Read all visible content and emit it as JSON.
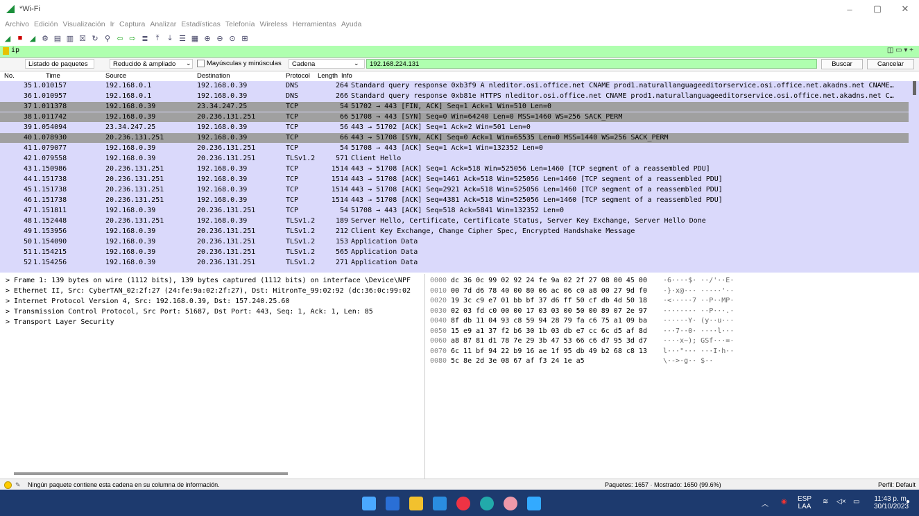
{
  "window": {
    "title": "*Wi-Fi",
    "minimize": "–",
    "maximize": "▢",
    "close": "✕"
  },
  "menu": [
    "Archivo",
    "Edición",
    "Visualización",
    "Ir",
    "Captura",
    "Analizar",
    "Estadísticas",
    "Telefonía",
    "Wireless",
    "Herramientas",
    "Ayuda"
  ],
  "filter": {
    "value": "ip",
    "right_controls": "◫ ▭ ▾ +"
  },
  "search": {
    "scope": "Listado de paquetes",
    "mode": "Reducido & ampliado",
    "case_label": "Mayúsculas y minúsculas",
    "type": "Cadena",
    "query": "192.168.224.131",
    "find": "Buscar",
    "cancel": "Cancelar"
  },
  "columns": {
    "no": "No.",
    "time": "Time",
    "source": "Source",
    "destination": "Destination",
    "protocol": "Protocol",
    "length": "Length",
    "info": "Info"
  },
  "packets": [
    {
      "no": "35",
      "time": "1.010157",
      "src": "192.168.0.1",
      "dst": "192.168.0.39",
      "proto": "DNS",
      "len": "264",
      "info": "Standard query response 0xb3f9 A nleditor.osi.office.net CNAME prod1.naturallanguageeditorservice.osi.office.net.akadns.net CNAME…",
      "style": "dns"
    },
    {
      "no": "36",
      "time": "1.010957",
      "src": "192.168.0.1",
      "dst": "192.168.0.39",
      "proto": "DNS",
      "len": "266",
      "info": "Standard query response 0xb81e HTTPS nleditor.osi.office.net CNAME prod1.naturallanguageeditorservice.osi.office.net.akadns.net C…",
      "style": "dns"
    },
    {
      "no": "37",
      "time": "1.011378",
      "src": "192.168.0.39",
      "dst": "23.34.247.25",
      "proto": "TCP",
      "len": "54",
      "info": "51702 → 443 [FIN, ACK] Seq=1 Ack=1 Win=510 Len=0",
      "style": "dark"
    },
    {
      "no": "38",
      "time": "1.011742",
      "src": "192.168.0.39",
      "dst": "20.236.131.251",
      "proto": "TCP",
      "len": "66",
      "info": "51708 → 443 [SYN] Seq=0 Win=64240 Len=0 MSS=1460 WS=256 SACK_PERM",
      "style": "dark"
    },
    {
      "no": "39",
      "time": "1.054094",
      "src": "23.34.247.25",
      "dst": "192.168.0.39",
      "proto": "TCP",
      "len": "56",
      "info": "443 → 51702 [ACK] Seq=1 Ack=2 Win=501 Len=0",
      "style": "tcp"
    },
    {
      "no": "40",
      "time": "1.078930",
      "src": "20.236.131.251",
      "dst": "192.168.0.39",
      "proto": "TCP",
      "len": "66",
      "info": "443 → 51708 [SYN, ACK] Seq=0 Ack=1 Win=65535 Len=0 MSS=1440 WS=256 SACK_PERM",
      "style": "dark"
    },
    {
      "no": "41",
      "time": "1.079077",
      "src": "192.168.0.39",
      "dst": "20.236.131.251",
      "proto": "TCP",
      "len": "54",
      "info": "51708 → 443 [ACK] Seq=1 Ack=1 Win=132352 Len=0",
      "style": "tcp"
    },
    {
      "no": "42",
      "time": "1.079558",
      "src": "192.168.0.39",
      "dst": "20.236.131.251",
      "proto": "TLSv1.2",
      "len": "571",
      "info": "Client Hello",
      "style": "tcp"
    },
    {
      "no": "43",
      "time": "1.150986",
      "src": "20.236.131.251",
      "dst": "192.168.0.39",
      "proto": "TCP",
      "len": "1514",
      "info": "443 → 51708 [ACK] Seq=1 Ack=518 Win=525056 Len=1460 [TCP segment of a reassembled PDU]",
      "style": "tcp"
    },
    {
      "no": "44",
      "time": "1.151738",
      "src": "20.236.131.251",
      "dst": "192.168.0.39",
      "proto": "TCP",
      "len": "1514",
      "info": "443 → 51708 [ACK] Seq=1461 Ack=518 Win=525056 Len=1460 [TCP segment of a reassembled PDU]",
      "style": "tcp"
    },
    {
      "no": "45",
      "time": "1.151738",
      "src": "20.236.131.251",
      "dst": "192.168.0.39",
      "proto": "TCP",
      "len": "1514",
      "info": "443 → 51708 [ACK] Seq=2921 Ack=518 Win=525056 Len=1460 [TCP segment of a reassembled PDU]",
      "style": "tcp"
    },
    {
      "no": "46",
      "time": "1.151738",
      "src": "20.236.131.251",
      "dst": "192.168.0.39",
      "proto": "TCP",
      "len": "1514",
      "info": "443 → 51708 [ACK] Seq=4381 Ack=518 Win=525056 Len=1460 [TCP segment of a reassembled PDU]",
      "style": "tcp"
    },
    {
      "no": "47",
      "time": "1.151811",
      "src": "192.168.0.39",
      "dst": "20.236.131.251",
      "proto": "TCP",
      "len": "54",
      "info": "51708 → 443 [ACK] Seq=518 Ack=5841 Win=132352 Len=0",
      "style": "tcp"
    },
    {
      "no": "48",
      "time": "1.152448",
      "src": "20.236.131.251",
      "dst": "192.168.0.39",
      "proto": "TLSv1.2",
      "len": "189",
      "info": "Server Hello, Certificate, Certificate Status, Server Key Exchange, Server Hello Done",
      "style": "tcp"
    },
    {
      "no": "49",
      "time": "1.153956",
      "src": "192.168.0.39",
      "dst": "20.236.131.251",
      "proto": "TLSv1.2",
      "len": "212",
      "info": "Client Key Exchange, Change Cipher Spec, Encrypted Handshake Message",
      "style": "tcp"
    },
    {
      "no": "50",
      "time": "1.154090",
      "src": "192.168.0.39",
      "dst": "20.236.131.251",
      "proto": "TLSv1.2",
      "len": "153",
      "info": "Application Data",
      "style": "tcp"
    },
    {
      "no": "51",
      "time": "1.154215",
      "src": "192.168.0.39",
      "dst": "20.236.131.251",
      "proto": "TLSv1.2",
      "len": "565",
      "info": "Application Data",
      "style": "tcp"
    },
    {
      "no": "52",
      "time": "1.154256",
      "src": "192.168.0.39",
      "dst": "20.236.131.251",
      "proto": "TLSv1.2",
      "len": "271",
      "info": "Application Data",
      "style": "tcp"
    }
  ],
  "details": [
    "> Frame 1: 139 bytes on wire (1112 bits), 139 bytes captured (1112 bits) on interface \\Device\\NPF",
    "> Ethernet II, Src: CyberTAN_02:2f:27 (24:fe:9a:02:2f:27), Dst: HitronTe_99:02:92 (dc:36:0c:99:02",
    "> Internet Protocol Version 4, Src: 192.168.0.39, Dst: 157.240.25.60",
    "> Transmission Control Protocol, Src Port: 51687, Dst Port: 443, Seq: 1, Ack: 1, Len: 85",
    "> Transport Layer Security"
  ],
  "hex": [
    {
      "off": "0000",
      "bytes": "dc 36 0c 99 02 92 24 fe  9a 02 2f 27 08 00 45 00",
      "ascii": "·6····$· ··/'··E·"
    },
    {
      "off": "0010",
      "bytes": "00 7d d6 78 40 00 80 06  ac 06 c0 a8 00 27 9d f0",
      "ascii": "·}·x@··· ·····'··"
    },
    {
      "off": "0020",
      "bytes": "19 3c c9 e7 01 bb bf 37  d6 ff 50 cf db 4d 50 18",
      "ascii": "·<·····7 ··P··MP·"
    },
    {
      "off": "0030",
      "bytes": "02 03 fd c0 00 00 17 03  03 00 50 00 89 07 2e 97",
      "ascii": "········ ··P···.·"
    },
    {
      "off": "0040",
      "bytes": "8f db 11 04 93 c8 59 94  28 79 fa c6 75 a1 09 ba",
      "ascii": "······Y· (y··u···"
    },
    {
      "off": "0050",
      "bytes": "15 e9 a1 37 f2 b6 30 1b  03 db e7 cc 6c d5 af 8d",
      "ascii": "···7··0· ····l···"
    },
    {
      "off": "0060",
      "bytes": "a8 87 81 d1 78 7e 29 3b  47 53 66 c6 d7 95 3d d7",
      "ascii": "····x~); GSf···=·"
    },
    {
      "off": "0070",
      "bytes": "6c 11 bf 94 22 b9 16 ae  1f 95 db 49 b2 68 c8 13",
      "ascii": "l···\"··· ···I·h··"
    },
    {
      "off": "0080",
      "bytes": "5c 8e 2d 3e 08 67 af f3  24 1e a5",
      "ascii": "\\·->·g·· $··"
    }
  ],
  "status": {
    "message": "Ningún paquete contiene esta cadena en su columna de información.",
    "packets": "Paquetes: 1657 · Mostrado: 1650 (99.6%)",
    "profile": "Perfil: Default"
  },
  "tray": {
    "lang1": "ESP",
    "lang2": "LAA",
    "time": "11:43 p. m.",
    "date": "30/10/2023"
  },
  "colors": {
    "accent_green": "#afffaf",
    "dark_row": "#a0a0a0",
    "tcp_row": "#dad9fb",
    "taskbar": "#1d3a6e"
  }
}
